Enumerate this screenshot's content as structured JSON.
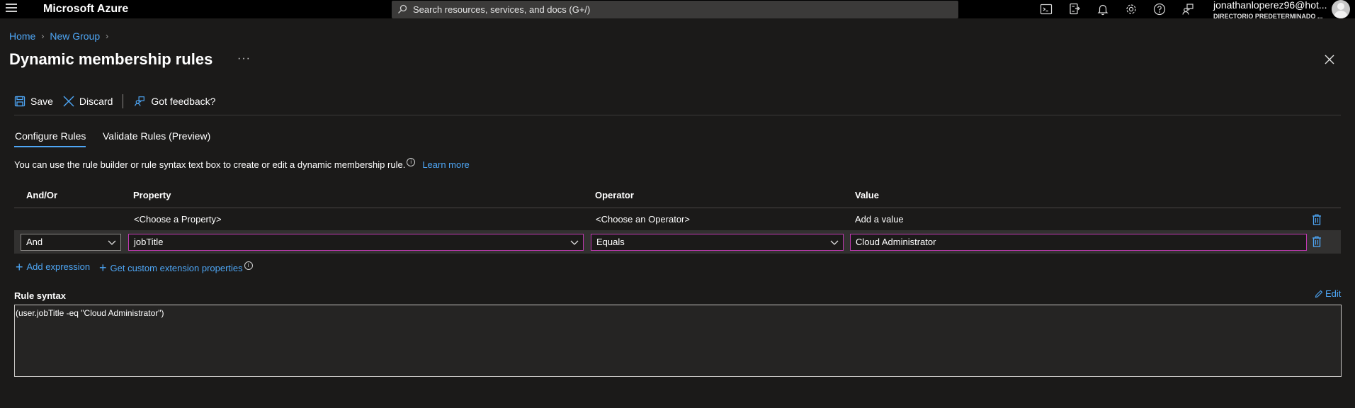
{
  "topbar": {
    "brand": "Microsoft Azure",
    "search_placeholder": "Search resources, services, and docs (G+/)",
    "account_name": "jonathanloperez96@hot...",
    "account_directory": "DIRECTORIO PREDETERMINADO ..."
  },
  "breadcrumb": {
    "items": [
      "Home",
      "New Group"
    ]
  },
  "page": {
    "title": "Dynamic membership rules",
    "more": "···"
  },
  "toolbar": {
    "save": "Save",
    "discard": "Discard",
    "feedback": "Got feedback?"
  },
  "tabs": [
    {
      "label": "Configure Rules",
      "active": true
    },
    {
      "label": "Validate Rules (Preview)",
      "active": false
    }
  ],
  "description": {
    "text": "You can use the rule builder or rule syntax text box to create or edit a dynamic membership rule.",
    "learn_more": "Learn more"
  },
  "table": {
    "headers": [
      "And/Or",
      "Property",
      "Operator",
      "Value"
    ],
    "rows": [
      {
        "and_or": "",
        "property": "<Choose a Property>",
        "operator": "<Choose an Operator>",
        "value": "Add a value"
      },
      {
        "and_or": "And",
        "property": "jobTitle",
        "operator": "Equals",
        "value": "Cloud Administrator"
      }
    ]
  },
  "actions": {
    "add_expression": "Add expression",
    "custom_extension": "Get custom extension properties"
  },
  "rule_syntax": {
    "label": "Rule syntax",
    "edit": "Edit",
    "text": "(user.jobTitle -eq \"Cloud Administrator\")"
  },
  "colors": {
    "accent": "#4ea6f5",
    "focus_border": "#c239b3",
    "background": "#1b1a19",
    "topbar": "#000000"
  },
  "icons": [
    "menu-icon",
    "search-icon",
    "cloud-shell-icon",
    "directory-filter-icon",
    "bell-icon",
    "gear-icon",
    "help-icon",
    "feedback-icon",
    "save-icon",
    "discard-icon",
    "close-icon",
    "trash-icon",
    "chevron-down-icon",
    "edit-icon",
    "info-icon"
  ]
}
